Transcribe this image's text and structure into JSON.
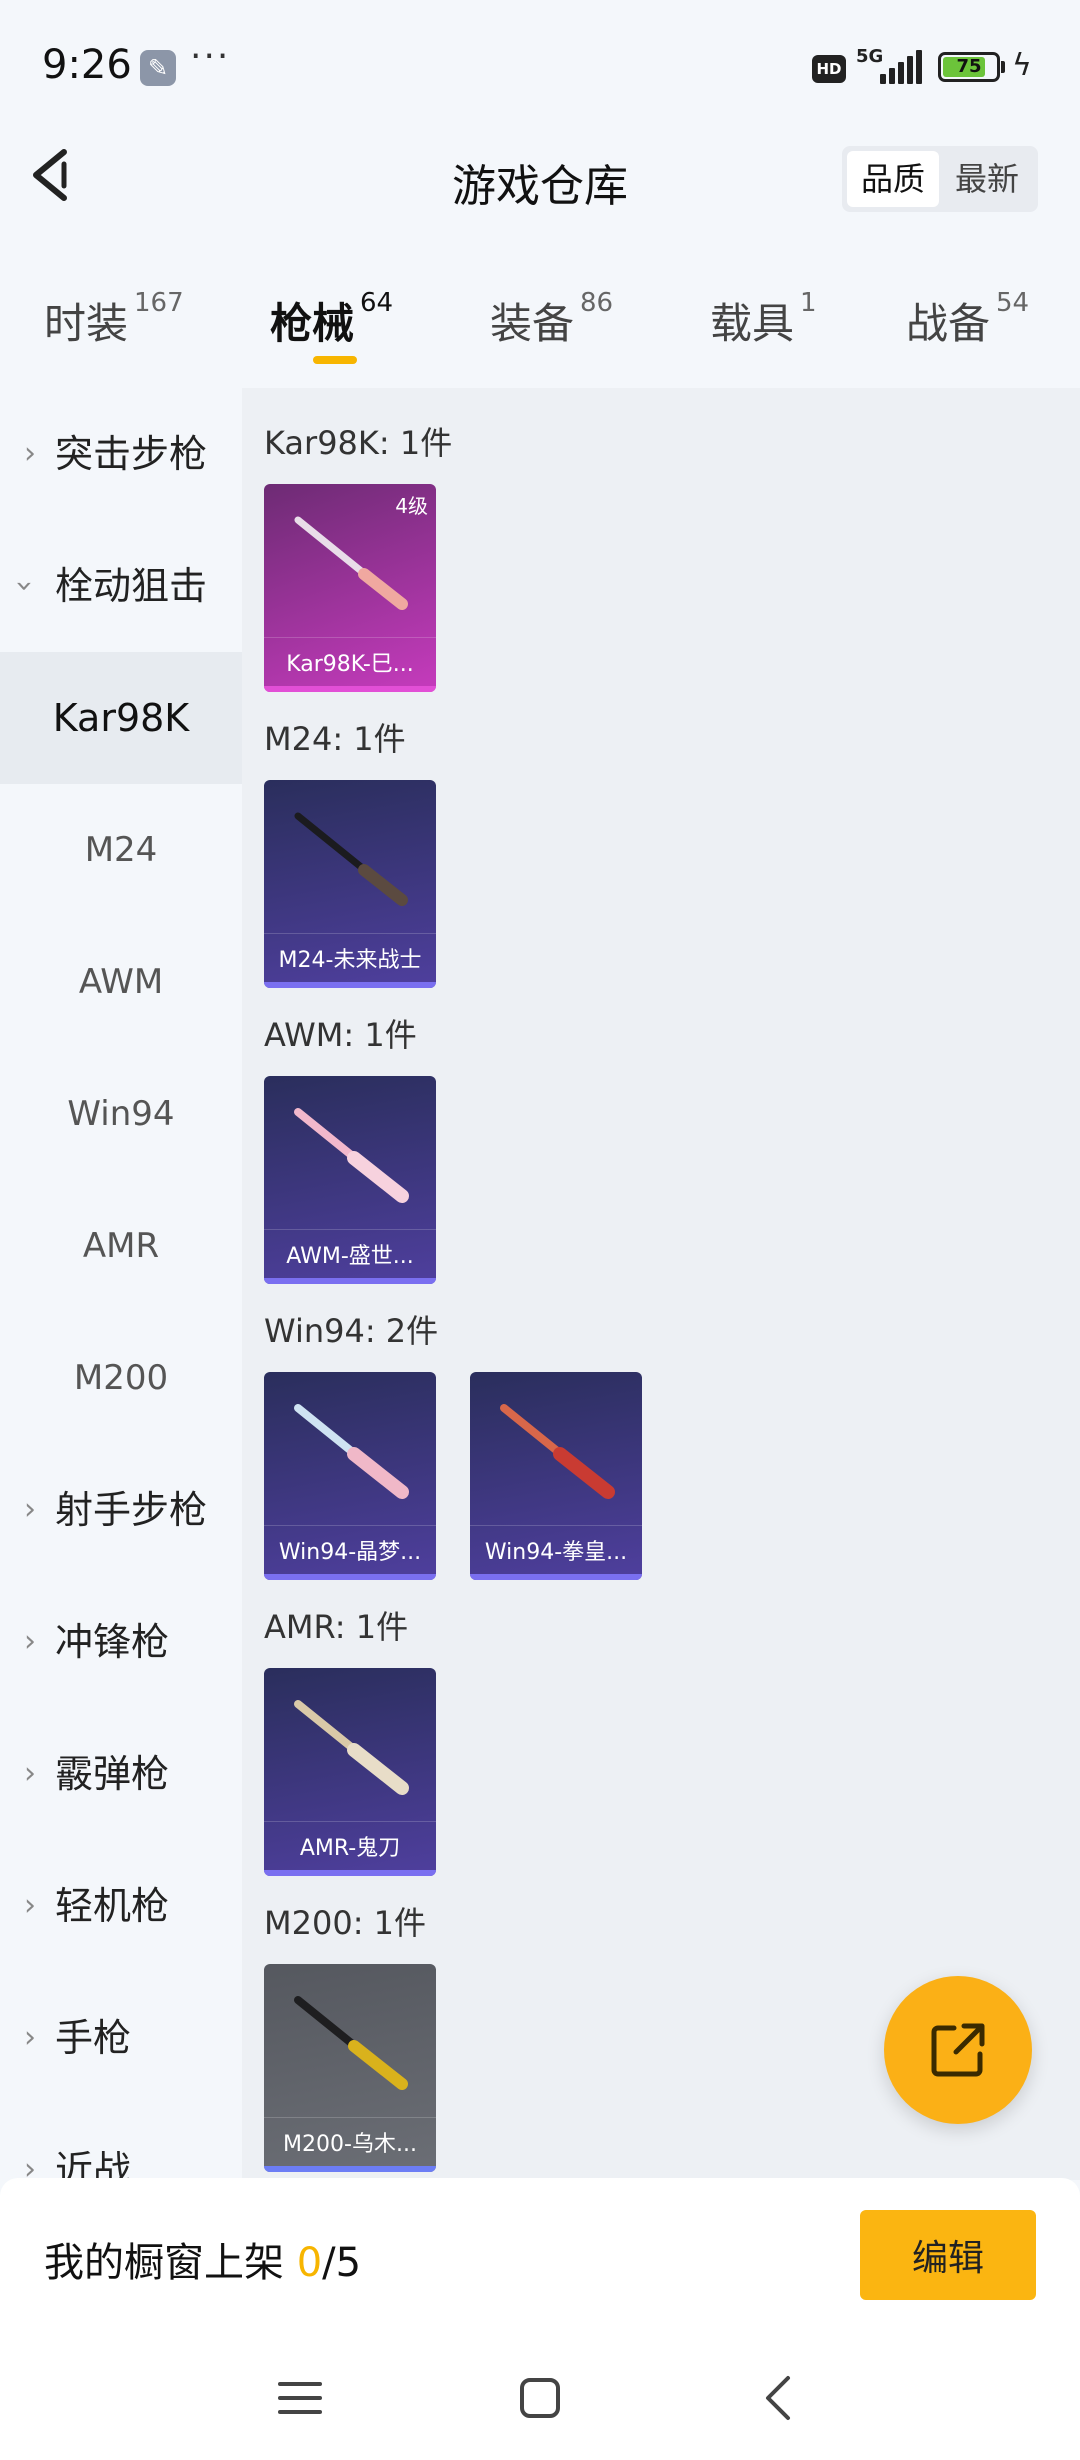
{
  "status_bar": {
    "time": "9:26",
    "network": "5G",
    "battery": "75",
    "icons": [
      "wrench-icon",
      "more-dots-icon",
      "hd-icon",
      "signal-icon",
      "battery-icon",
      "charging-icon"
    ]
  },
  "header": {
    "title": "游戏仓库",
    "sort_options": [
      "品质",
      "最新"
    ]
  },
  "tabs": [
    {
      "label": "时装",
      "count": "167"
    },
    {
      "label": "枪械",
      "count": "64"
    },
    {
      "label": "装备",
      "count": "86"
    },
    {
      "label": "载具",
      "count": "1"
    },
    {
      "label": "战备",
      "count": "54"
    }
  ],
  "sidebar": {
    "categories": [
      {
        "label": "突击步枪"
      },
      {
        "label": "栓动狙击"
      },
      {
        "label": "射手步枪"
      },
      {
        "label": "冲锋枪"
      },
      {
        "label": "霰弹枪"
      },
      {
        "label": "轻机枪"
      },
      {
        "label": "手枪"
      },
      {
        "label": "近战"
      }
    ],
    "subitems": [
      "Kar98K",
      "M24",
      "AWM",
      "Win94",
      "AMR",
      "M200"
    ]
  },
  "groups": [
    {
      "title": "Kar98K: 1件",
      "items": [
        {
          "name": "Kar98K-巳...",
          "level": "4级",
          "color": "#c63bbd"
        }
      ]
    },
    {
      "title": "M24: 1件",
      "items": [
        {
          "name": "M24-未来战士",
          "color": "#4f3f9e"
        }
      ]
    },
    {
      "title": "AWM: 1件",
      "items": [
        {
          "name": "AWM-盛世...",
          "color": "#4f3f9e"
        }
      ]
    },
    {
      "title": "Win94: 2件",
      "items": [
        {
          "name": "Win94-晶梦...",
          "color": "#4f3f9e"
        },
        {
          "name": "Win94-拳皇...",
          "color": "#4f3f9e"
        }
      ]
    },
    {
      "title": "AMR: 1件",
      "items": [
        {
          "name": "AMR-鬼刀",
          "color": "#4f3f9e"
        }
      ]
    },
    {
      "title": "M200: 1件",
      "items": [
        {
          "name": "M200-乌木...",
          "color": "#6b6e75"
        }
      ]
    }
  ],
  "bottom": {
    "showcase_label": "我的橱窗上架",
    "showcase_count": "0",
    "showcase_total": "/5",
    "edit_label": "编辑"
  },
  "colors": {
    "accent": "#f7b500",
    "fab": "#fbb016"
  }
}
